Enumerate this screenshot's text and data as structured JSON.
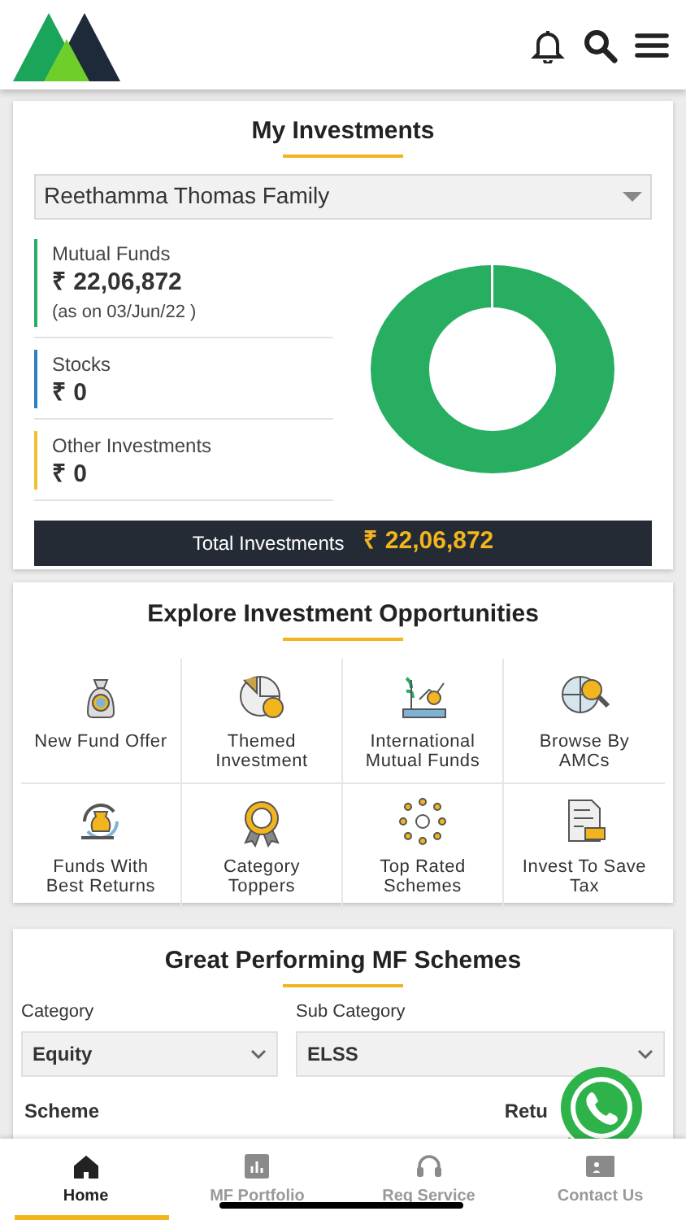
{
  "my_investments": {
    "title": "My Investments",
    "family_select": {
      "value": "Reethamma Thomas Family"
    },
    "items": [
      {
        "label": "Mutual Funds",
        "amount": "₹ 22,06,872",
        "note": "(as on 03/Jun/22 )",
        "color": "#27ae60"
      },
      {
        "label": "Stocks",
        "amount": "₹ 0",
        "color": "#2f80c0"
      },
      {
        "label": "Other Investments",
        "amount": "₹ 0",
        "color": "#f2c12e"
      }
    ],
    "total": {
      "label": "Total Investments",
      "amount": "₹ 22,06,872"
    }
  },
  "explore": {
    "title": "Explore Investment Opportunities",
    "tiles": [
      {
        "label": "New Fund Offer",
        "kind": "bag"
      },
      {
        "label": "Themed Investment",
        "kind": "pie"
      },
      {
        "label": "International Mutual Funds",
        "kind": "growth"
      },
      {
        "label": "Browse By AMCs",
        "kind": "globe"
      },
      {
        "label": "Funds With Best Returns",
        "kind": "returns"
      },
      {
        "label": "Category Toppers",
        "kind": "medal"
      },
      {
        "label": "Top Rated Schemes",
        "kind": "network"
      },
      {
        "label": "Invest To Save Tax",
        "kind": "tax"
      }
    ]
  },
  "schemes": {
    "title": "Great Performing MF Schemes",
    "category": {
      "label": "Category",
      "value": "Equity"
    },
    "sub_category": {
      "label": "Sub Category",
      "value": "ELSS"
    },
    "columns": [
      "Scheme",
      "Retu"
    ]
  },
  "bottom_nav": [
    {
      "label": "Home",
      "selected": true
    },
    {
      "label": "MF Portfolio",
      "selected": false
    },
    {
      "label": "Req Service",
      "selected": false
    },
    {
      "label": "Contact Us",
      "selected": false
    }
  ]
}
